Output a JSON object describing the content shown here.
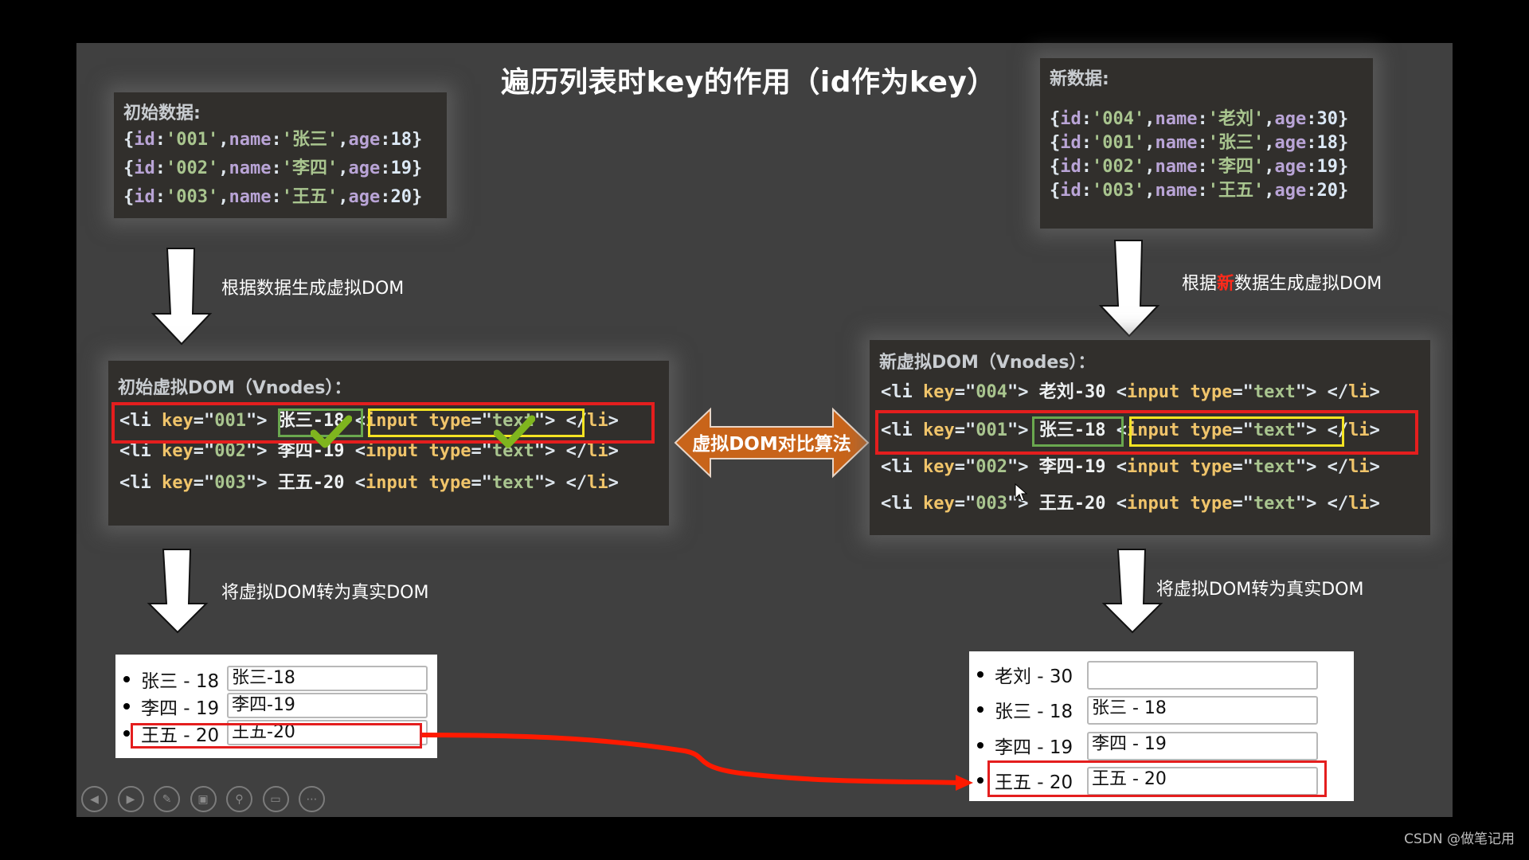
{
  "slide": {
    "title": "遍历列表时key的作用（id作为key）"
  },
  "initial_data": {
    "heading": "初始数据:",
    "items": [
      {
        "id": "001",
        "name": "张三",
        "age": "18"
      },
      {
        "id": "002",
        "name": "李四",
        "age": "19"
      },
      {
        "id": "003",
        "name": "王五",
        "age": "20"
      }
    ]
  },
  "new_data": {
    "heading": "新数据:",
    "items": [
      {
        "id": "004",
        "name": "老刘",
        "age": "30"
      },
      {
        "id": "001",
        "name": "张三",
        "age": "18"
      },
      {
        "id": "002",
        "name": "李四",
        "age": "19"
      },
      {
        "id": "003",
        "name": "王五",
        "age": "20"
      }
    ]
  },
  "captions": {
    "gen_vdom_left": "根据数据生成虚拟DOM",
    "gen_vdom_right_pre": "根据",
    "gen_vdom_right_hl": "新",
    "gen_vdom_right_post": "数据生成虚拟DOM",
    "to_real_left": "将虚拟DOM转为真实DOM",
    "to_real_right": "将虚拟DOM转为真实DOM",
    "diff_algorithm": "虚拟DOM对比算法"
  },
  "initial_vdom": {
    "heading": "初始虚拟DOM（Vnodes）：",
    "rows": [
      {
        "key": "001",
        "text": "张三-18"
      },
      {
        "key": "002",
        "text": "李四-19"
      },
      {
        "key": "003",
        "text": "王五-20"
      }
    ]
  },
  "new_vdom": {
    "heading": "新虚拟DOM（Vnodes）：",
    "rows": [
      {
        "key": "004",
        "text": "老刘-30"
      },
      {
        "key": "001",
        "text": "张三-18"
      },
      {
        "key": "002",
        "text": "李四-19"
      },
      {
        "key": "003",
        "text": "王五-20"
      }
    ]
  },
  "code_tokens": {
    "li_open": "<li ",
    "key_attr": "key",
    "eq": "=",
    "quote": "\"",
    "close_angle": ">",
    "input_open": "<input ",
    "type_attr": "type",
    "text_val": "text",
    "li_close": "</li>"
  },
  "initial_real_dom": {
    "rows": [
      {
        "label": "张三 - 18",
        "input_value": "张三-18"
      },
      {
        "label": "李四 - 19",
        "input_value": "李四-19"
      },
      {
        "label": "王五 - 20",
        "input_value": "王五-20"
      }
    ]
  },
  "new_real_dom": {
    "rows": [
      {
        "label": "老刘 - 30",
        "input_value": ""
      },
      {
        "label": "张三 - 18",
        "input_value": "张三 - 18"
      },
      {
        "label": "李四 - 19",
        "input_value": "李四 - 19"
      },
      {
        "label": "王五 - 20",
        "input_value": "王五 - 20"
      }
    ]
  },
  "controls": [
    {
      "name": "previous-slide",
      "icon": "◀"
    },
    {
      "name": "next-slide",
      "icon": "▶"
    },
    {
      "name": "pen",
      "icon": "✎"
    },
    {
      "name": "see-all-slides",
      "icon": "▣"
    },
    {
      "name": "zoom",
      "icon": "⚲"
    },
    {
      "name": "subtitles",
      "icon": "▭"
    },
    {
      "name": "more-options",
      "icon": "⋯"
    }
  ],
  "colors": {
    "highlight_red": "#e41e1e",
    "match_green": "#6aa84f",
    "match_yellow": "#f4e423",
    "diff_orange": "#c8641a"
  },
  "watermark": "CSDN @做笔记用"
}
